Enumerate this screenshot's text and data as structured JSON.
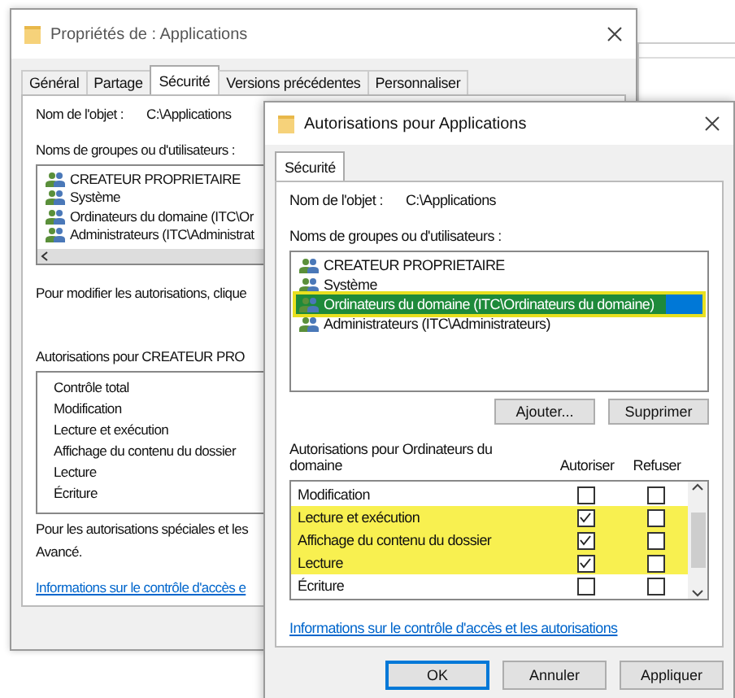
{
  "back_window": {
    "title": "Propriétés de : Applications",
    "tabs": [
      {
        "label": "Général",
        "selected": false
      },
      {
        "label": "Partage",
        "selected": false
      },
      {
        "label": "Sécurité",
        "selected": true
      },
      {
        "label": "Versions précédentes",
        "selected": false
      },
      {
        "label": "Personnaliser",
        "selected": false
      }
    ],
    "object_label": "Nom de l'objet :",
    "object_value": "C:\\Applications",
    "groups_label": "Noms de groupes ou d'utilisateurs :",
    "groups": [
      {
        "name": "CREATEUR PROPRIETAIRE"
      },
      {
        "name": "Système"
      },
      {
        "name": "Ordinateurs du domaine (ITC\\Or"
      },
      {
        "name": "Administrateurs (ITC\\Administrat"
      }
    ],
    "modify_hint": "Pour modifier les autorisations, clique",
    "permissions_label": "Autorisations pour CREATEUR PRO",
    "permissions": [
      "Contrôle total",
      "Modification",
      "Lecture et exécution",
      "Affichage du contenu du dossier",
      "Lecture",
      "Écriture"
    ],
    "special_hint": "Pour les autorisations spéciales et les",
    "special_hint_end": "Avancé.",
    "link": "Informations sur le contrôle d'accès e"
  },
  "dialog": {
    "title": "Autorisations pour Applications",
    "tabs": [
      {
        "label": "Sécurité",
        "selected": true
      }
    ],
    "object_label": "Nom de l'objet :",
    "object_value": "C:\\Applications",
    "groups_label": "Noms de groupes ou d'utilisateurs :",
    "groups": [
      {
        "name": "CREATEUR PROPRIETAIRE",
        "selected": false,
        "highlighted": false
      },
      {
        "name": "Système",
        "selected": false,
        "highlighted": false
      },
      {
        "name": "Ordinateurs du domaine (ITC\\Ordinateurs du domaine)",
        "selected": true,
        "highlighted": true
      },
      {
        "name": "Administrateurs (ITC\\Administrateurs)",
        "selected": false,
        "highlighted": false
      }
    ],
    "group_buttons": [
      "Ajouter...",
      "Supprimer"
    ],
    "permissions_label": "Autorisations pour Ordinateurs du domaine",
    "allow_header": "Autoriser",
    "deny_header": "Refuser",
    "permissions": [
      {
        "name": "Modification",
        "allow": false,
        "deny": false,
        "highlighted": false
      },
      {
        "name": "Lecture et exécution",
        "allow": true,
        "deny": false,
        "highlighted": true
      },
      {
        "name": "Affichage du contenu du dossier",
        "allow": true,
        "deny": false,
        "highlighted": true
      },
      {
        "name": "Lecture",
        "allow": true,
        "deny": false,
        "highlighted": true
      },
      {
        "name": "Écriture",
        "allow": false,
        "deny": false,
        "highlighted": false
      }
    ],
    "link": "Informations sur le contrôle d'accès et les autorisations",
    "buttons": [
      {
        "label": "OK",
        "default": true
      },
      {
        "label": "Annuler",
        "default": false
      },
      {
        "label": "Appliquer",
        "default": false
      }
    ]
  }
}
